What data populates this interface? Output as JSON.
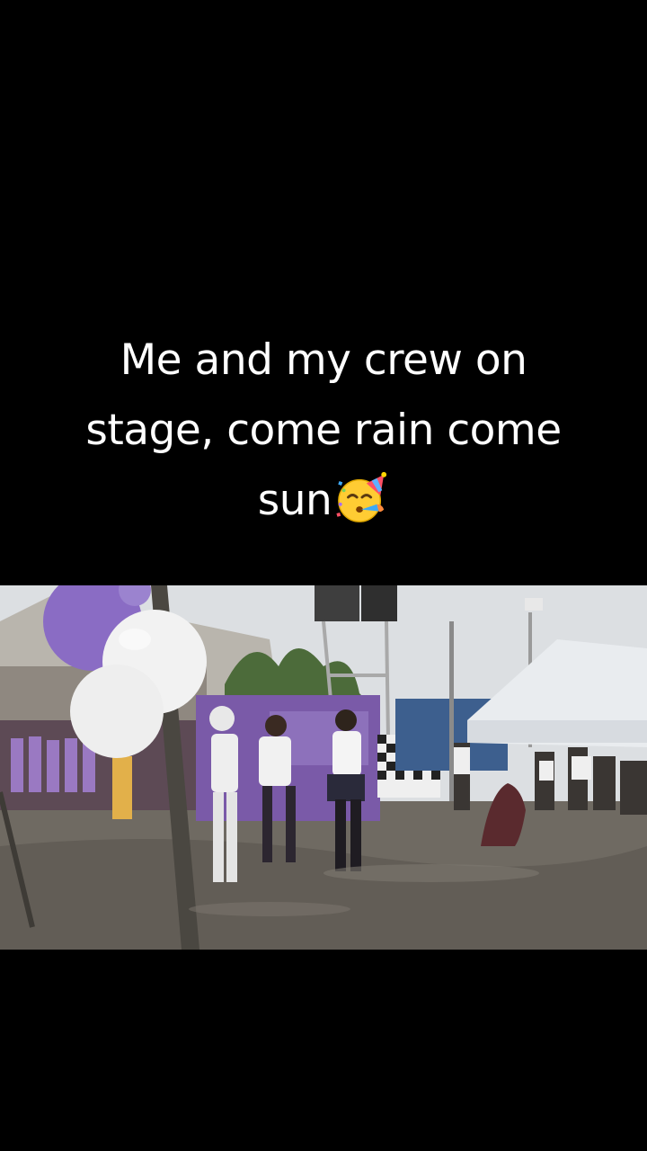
{
  "caption": {
    "line1": "Me and my crew on",
    "line2": "stage, come rain come",
    "line3": "sun"
  },
  "icons": {
    "caption_emoji": "partying-face-emoji"
  },
  "photo": {
    "subject": "",
    "colors": {
      "sky": "#dcdfe2",
      "ground": "#6f6a62",
      "banner": "#7a5aa8",
      "balloon_purple": "#8a6cc4",
      "balloon_white": "#f2f2f2",
      "tent": "#e9ecef"
    }
  }
}
